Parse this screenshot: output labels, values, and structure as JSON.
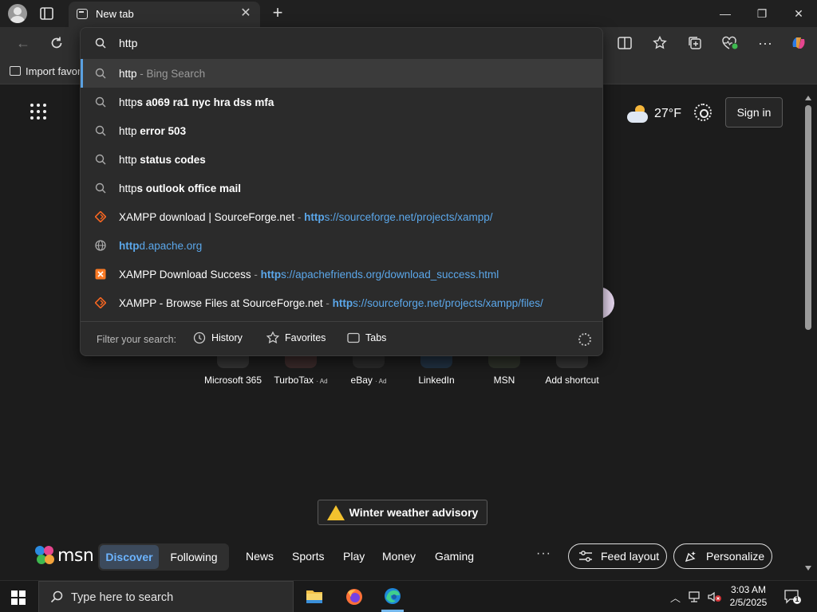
{
  "tab": {
    "title": "New tab",
    "close": "✕",
    "new": "+"
  },
  "window": {
    "minimize": "—",
    "maximize": "❐",
    "close": "✕"
  },
  "favorites_bar": {
    "import_label": "Import favor"
  },
  "omnibox": {
    "query": "http",
    "suggestions": [
      {
        "type": "search",
        "typed": "http",
        "rest": "",
        "suffix": " - Bing Search",
        "selected": true
      },
      {
        "type": "search",
        "typed": "http",
        "rest": "s a069 ra1 nyc hra dss mfa"
      },
      {
        "type": "search",
        "typed": "http",
        "rest": " error 503"
      },
      {
        "type": "search",
        "typed": "http",
        "rest": " status codes"
      },
      {
        "type": "search",
        "typed": "http",
        "rest": "s outlook office mail"
      },
      {
        "type": "site",
        "icon": "sourceforge-icon",
        "title": "XAMPP download | SourceForge.net",
        "sep": " - ",
        "url_typed": "http",
        "url_rest": "s://sourceforge.net/projects/xampp/"
      },
      {
        "type": "url",
        "icon": "globe-icon",
        "url_typed": "http",
        "url_rest": "d.apache.org"
      },
      {
        "type": "site",
        "icon": "xampp-icon",
        "title": "XAMPP Download Success",
        "sep": " - ",
        "url_typed": "http",
        "url_rest": "s://apachefriends.org/download_success.html"
      },
      {
        "type": "site",
        "icon": "sourceforge-icon",
        "title": "XAMPP - Browse Files at SourceForge.net",
        "sep": " - ",
        "url_typed": "http",
        "url_rest": "s://sourceforge.net/projects/xampp/files/"
      }
    ],
    "filter": {
      "label": "Filter your search:",
      "history": "History",
      "favorites": "Favorites",
      "tabs": "Tabs"
    }
  },
  "newtab": {
    "weather_temp": "27°F",
    "signin": "Sign in",
    "shortcuts": [
      {
        "label": "Microsoft 365",
        "ad": ""
      },
      {
        "label": "TurboTax",
        "ad": "· Ad"
      },
      {
        "label": "eBay",
        "ad": "· Ad"
      },
      {
        "label": "LinkedIn",
        "ad": ""
      },
      {
        "label": "MSN",
        "ad": ""
      },
      {
        "label": "Add shortcut",
        "ad": ""
      }
    ],
    "advisory": "Winter weather advisory"
  },
  "msn": {
    "logo": "msn",
    "discover": "Discover",
    "following": "Following",
    "nav": [
      "News",
      "Sports",
      "Play",
      "Money",
      "Gaming"
    ],
    "more": "···",
    "feed_layout": "Feed layout",
    "personalize": "Personalize"
  },
  "taskbar": {
    "search_placeholder": "Type here to search",
    "time": "3:03 AM",
    "date": "2/5/2025",
    "notification_count": "1"
  },
  "colors": {
    "accent": "#5ba7ea",
    "edge_blue": "#1e88d8",
    "warning": "#f2c12e"
  }
}
